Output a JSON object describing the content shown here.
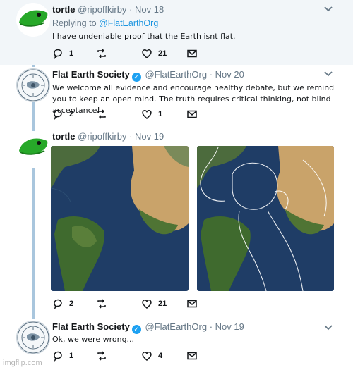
{
  "tweets": [
    {
      "name": "tortle",
      "handle": "@ripoffkirby",
      "date": "· Nov 18",
      "reply_prefix": "Replying to",
      "reply_to": "@FlatEarthOrg",
      "text": "I have undeniable proof that the Earth isnt flat.",
      "replies": "1",
      "retweets": "",
      "likes": "21"
    },
    {
      "name": "Flat Earth Society",
      "handle": "@FlatEarthOrg",
      "date": "· Nov 20",
      "text": "We welcome all evidence and encourage healthy debate, but we remind you to keep an open mind. The truth requires critical thinking, not blind acceptance!",
      "replies": "2",
      "retweets": "",
      "likes": "1"
    },
    {
      "name": "tortle",
      "handle": "@ripoffkirby",
      "date": "· Nov 19",
      "replies": "2",
      "retweets": "",
      "likes": "21"
    },
    {
      "name": "Flat Earth Society",
      "handle": "@FlatEarthOrg",
      "date": "· Nov 19",
      "text": "Ok, we were wrong...",
      "replies": "1",
      "retweets": "",
      "likes": "4"
    }
  ],
  "watermark": "imgflip.com",
  "colors": {
    "verified": "#1da1f2",
    "link": "#1b95e0",
    "thread": "#a9c6dd",
    "ocean": "#1d3a63",
    "land_green": "#3d6b2f",
    "desert": "#c9a36a"
  }
}
